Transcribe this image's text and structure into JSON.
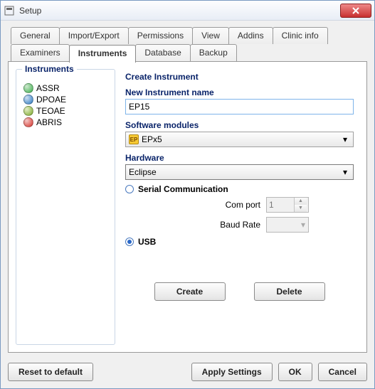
{
  "window": {
    "title": "Setup"
  },
  "tabs_row1": [
    {
      "label": "General"
    },
    {
      "label": "Import/Export"
    },
    {
      "label": "Permissions"
    },
    {
      "label": "View"
    },
    {
      "label": "Addins"
    },
    {
      "label": "Clinic info"
    }
  ],
  "tabs_row2": [
    {
      "label": "Examiners"
    },
    {
      "label": "Instruments"
    },
    {
      "label": "Database"
    },
    {
      "label": "Backup"
    }
  ],
  "active_tab": "Instruments",
  "instruments_group": {
    "label": "Instruments",
    "items": [
      {
        "name": "ASSR",
        "color": "#3aae4a"
      },
      {
        "name": "DPOAE",
        "color": "#2a78c0"
      },
      {
        "name": "TEOAE",
        "color": "#7aa92a"
      },
      {
        "name": "ABRIS",
        "color": "#d5312a"
      }
    ]
  },
  "form": {
    "section_title": "Create Instrument",
    "name_label": "New Instrument name",
    "name_value": "EP15",
    "software_label": "Software modules",
    "software_value": "EPx5",
    "software_icon_text": "EP",
    "hardware_label": "Hardware",
    "hardware_value": "Eclipse",
    "radio_serial_label": "Serial Communication",
    "radio_usb_label": "USB",
    "connection_selected": "USB",
    "comport_label": "Com port",
    "comport_value": "1",
    "baud_label": "Baud Rate",
    "baud_value": "",
    "create_btn": "Create",
    "delete_btn": "Delete"
  },
  "bottom": {
    "reset": "Reset to default",
    "apply": "Apply Settings",
    "ok": "OK",
    "cancel": "Cancel"
  }
}
